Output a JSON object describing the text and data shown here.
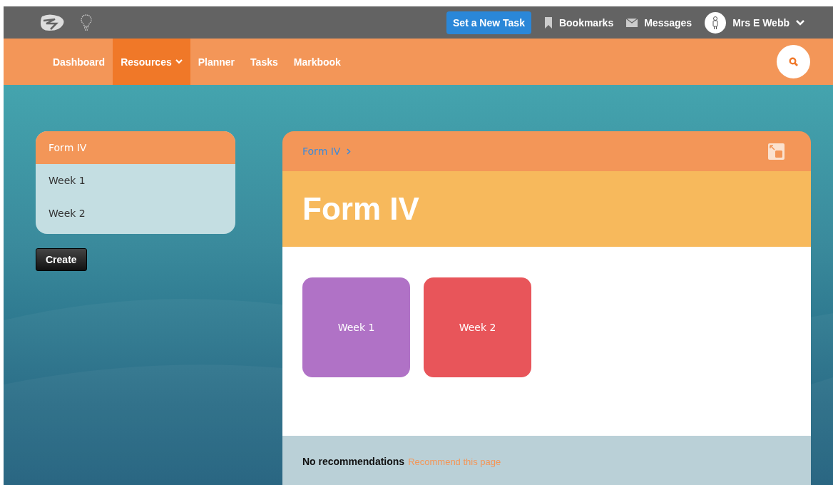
{
  "top_bar": {
    "new_task_button": "Set a New Task",
    "bookmarks": "Bookmarks",
    "messages": "Messages",
    "user": "Mrs E Webb"
  },
  "nav": [
    {
      "label": "Dashboard",
      "selected": false,
      "dropdown": false
    },
    {
      "label": "Resources",
      "selected": true,
      "dropdown": true
    },
    {
      "label": "Planner",
      "selected": false,
      "dropdown": false
    },
    {
      "label": "Tasks",
      "selected": false,
      "dropdown": false
    },
    {
      "label": "Markbook",
      "selected": false,
      "dropdown": false
    }
  ],
  "sidebar": {
    "items": [
      {
        "label": "Form IV",
        "selected": true
      },
      {
        "label": "Week 1",
        "selected": false
      },
      {
        "label": "Week 2",
        "selected": false
      }
    ],
    "create_button": "Create"
  },
  "content": {
    "breadcrumb": [
      "Form IV"
    ],
    "title": "Form IV",
    "tiles": [
      {
        "label": "Week 1",
        "color": "#b072c6"
      },
      {
        "label": "Week 2",
        "color": "#e8555a"
      }
    ],
    "recommendations": {
      "text": "No recommendations",
      "link": "Recommend this page"
    }
  }
}
